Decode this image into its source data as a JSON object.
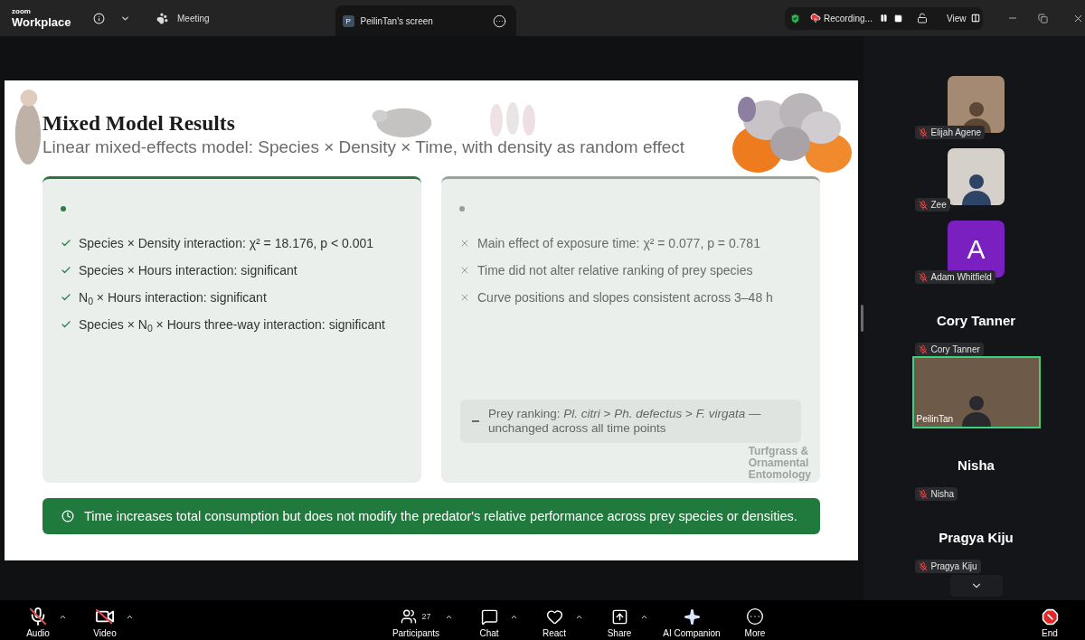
{
  "window": {
    "brand_small": "zoom",
    "brand": "Workplace",
    "meeting_label": "Meeting",
    "share_tab": {
      "avatar_initial": "P",
      "title": "PeilinTan's screen",
      "selected": true
    },
    "recording": {
      "label": "Recording..."
    },
    "view_label": "View"
  },
  "slide": {
    "title": "Mixed Model Results",
    "subtitle": "Linear mixed-effects model: Species × Density × Time, with density as random effect",
    "cards": [
      {
        "kind": "confirmed",
        "items": [
          "Species × Density interaction: χ² = 18.176, p < 0.001",
          "Species × Hours interaction: significant",
          "N$_{0}$ × Hours interaction: significant",
          "Species × N$_{0}$ × Hours three-way interaction: significant"
        ]
      },
      {
        "kind": "rejected",
        "items": [
          "Main effect of exposure time: χ² = 0.077, p = 0.781",
          "Time did not alter relative ranking of prey species",
          "Curve positions and slopes consistent across 3–48 h"
        ],
        "note": "Prey ranking: *Pl. citri* > *Ph. defectus* > *F. virgata* — unchanged across all time points"
      }
    ],
    "banner": "Time increases total consumption but does not modify the predator's relative performance across prey species or densities.",
    "logo_lines": [
      "Turfgrass &",
      "Ornamental",
      "Entomology"
    ]
  },
  "participants": [
    {
      "kind": "photo",
      "name": "Elijah Agene",
      "muted": true
    },
    {
      "kind": "photo",
      "name": "Zee",
      "muted": true
    },
    {
      "kind": "avatar",
      "initial": "A",
      "name": "Adam Whitfield",
      "muted": true
    },
    {
      "kind": "name",
      "display_name": "Cory Tanner",
      "name": "Cory Tanner",
      "muted": true
    },
    {
      "kind": "video",
      "name": "PeilinTan",
      "muted": false,
      "speaking": true
    },
    {
      "kind": "name",
      "display_name": "Nisha",
      "name": "Nisha",
      "muted": true
    },
    {
      "kind": "name",
      "display_name": "Pragya Kiju",
      "name": "Pragya Kiju",
      "muted": true
    }
  ],
  "toolbar": {
    "left": [
      {
        "kind": "audio",
        "label": "Audio",
        "off": true,
        "caret": true
      },
      {
        "kind": "video",
        "label": "Video",
        "off": true,
        "caret": true
      }
    ],
    "center": [
      {
        "kind": "participants",
        "label": "Participants",
        "count": "27",
        "caret": true
      },
      {
        "kind": "chat",
        "label": "Chat",
        "caret": true
      },
      {
        "kind": "react",
        "label": "React",
        "caret": true
      },
      {
        "kind": "share",
        "label": "Share",
        "caret": true
      },
      {
        "kind": "ai",
        "label": "AI Companion",
        "caret": false
      },
      {
        "kind": "more",
        "label": "More",
        "caret": false
      }
    ],
    "right": [
      {
        "kind": "end",
        "label": "End",
        "caret": false
      }
    ]
  }
}
